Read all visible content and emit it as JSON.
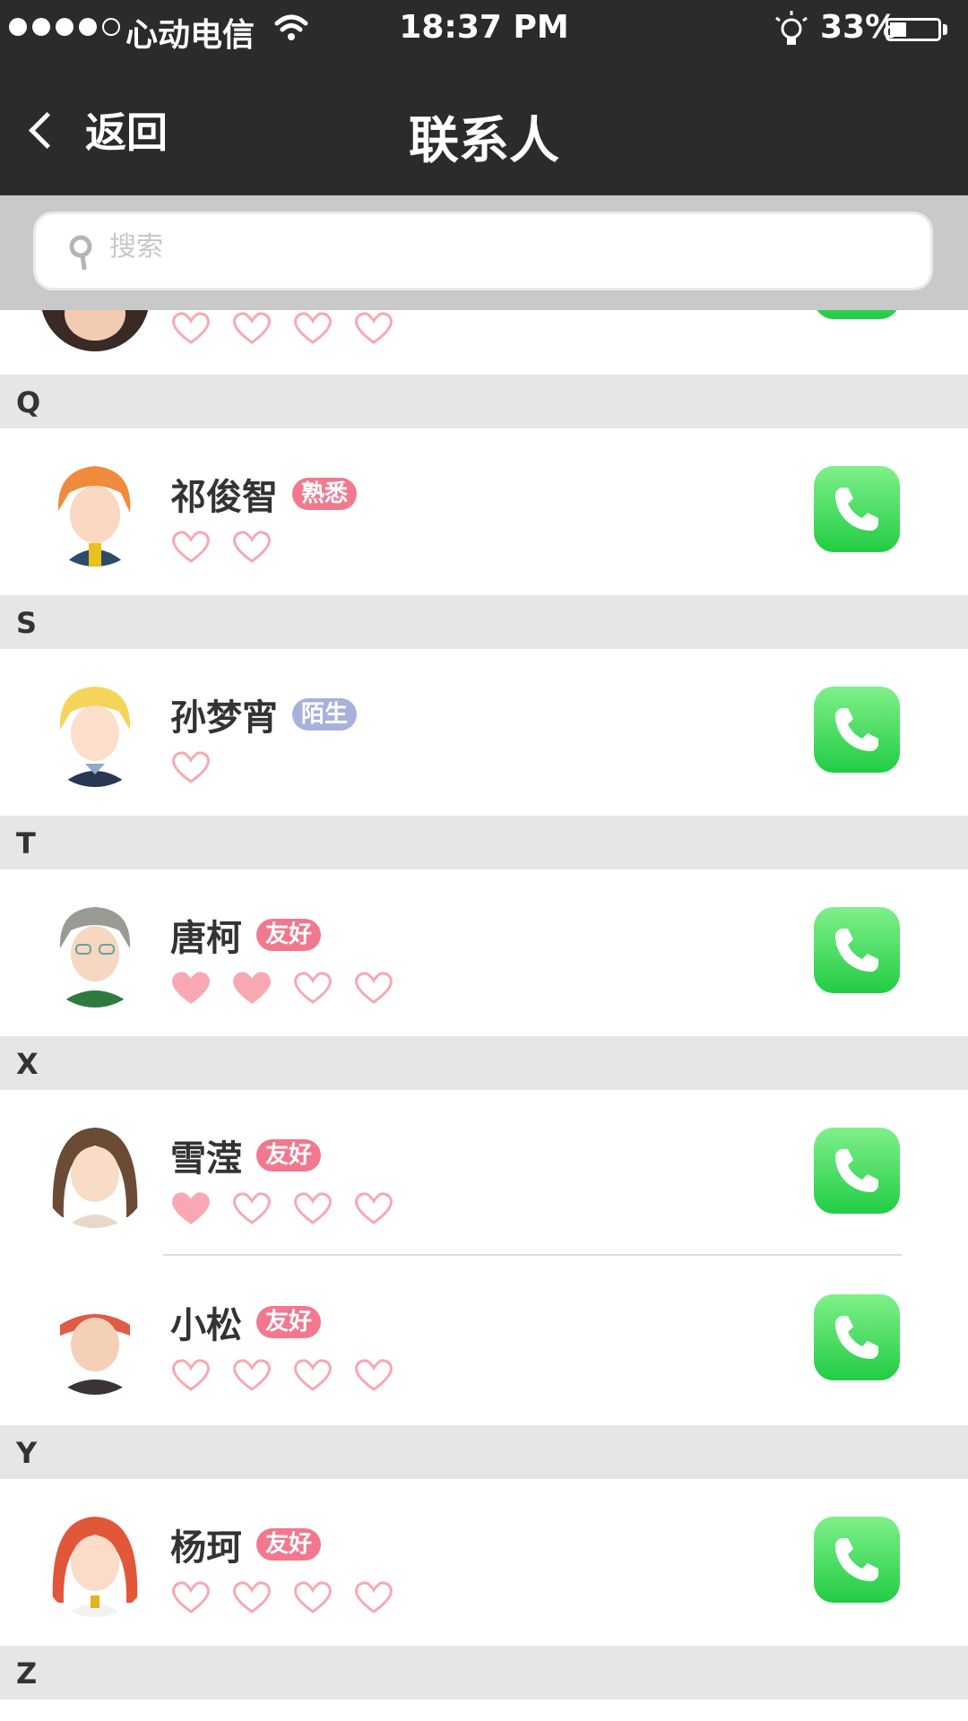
{
  "status_bar": {
    "carrier": "心动电信",
    "time": "18:37 PM",
    "battery": "33%",
    "battery_level": 0.33
  },
  "header": {
    "back_label": "返回",
    "title": "联系人"
  },
  "search": {
    "placeholder": "搜索"
  },
  "colors": {
    "header_bg": "#2b2b2d",
    "section_bg": "#e6e6e6",
    "badge_familiar": "#f2788e",
    "badge_stranger": "#a9b0dc",
    "badge_friendly": "#f2788e",
    "heart": "#f7a8b2",
    "call_green": "#32d84f"
  },
  "contacts": [
    {
      "name": "",
      "hearts": [
        0,
        0,
        0,
        0
      ]
    },
    {
      "section": "Q"
    },
    {
      "name": "祁俊智",
      "relation": "熟悉",
      "hearts": [
        0,
        0
      ]
    },
    {
      "section": "S"
    },
    {
      "name": "孙梦宵",
      "relation": "陌生",
      "hearts": [
        0
      ]
    },
    {
      "section": "T"
    },
    {
      "name": "唐柯",
      "relation": "友好",
      "hearts": [
        1,
        1,
        0,
        0
      ]
    },
    {
      "section": "X"
    },
    {
      "name": "雪滢",
      "relation": "友好",
      "hearts": [
        1,
        0,
        0,
        0
      ]
    },
    {
      "name": "小松",
      "relation": "友好",
      "hearts": [
        0,
        0,
        0,
        0
      ]
    },
    {
      "section": "Y"
    },
    {
      "name": "杨珂",
      "relation": "友好",
      "hearts": [
        0,
        0,
        0,
        0
      ]
    },
    {
      "section": "Z"
    }
  ],
  "sections": {
    "q": "Q",
    "s": "S",
    "t": "T",
    "x": "X",
    "y": "Y",
    "z": "Z"
  },
  "rows": {
    "r1": {
      "name": "祁俊智",
      "relation": "熟悉"
    },
    "r2": {
      "name": "孙梦宵",
      "relation": "陌生"
    },
    "r3": {
      "name": "唐柯",
      "relation": "友好"
    },
    "r4": {
      "name": "雪滢",
      "relation": "友好"
    },
    "r5": {
      "name": "小松",
      "relation": "友好"
    },
    "r6": {
      "name": "杨珂",
      "relation": "友好"
    }
  },
  "icons": {
    "heart": "heart-icon",
    "call": "phone-icon"
  }
}
